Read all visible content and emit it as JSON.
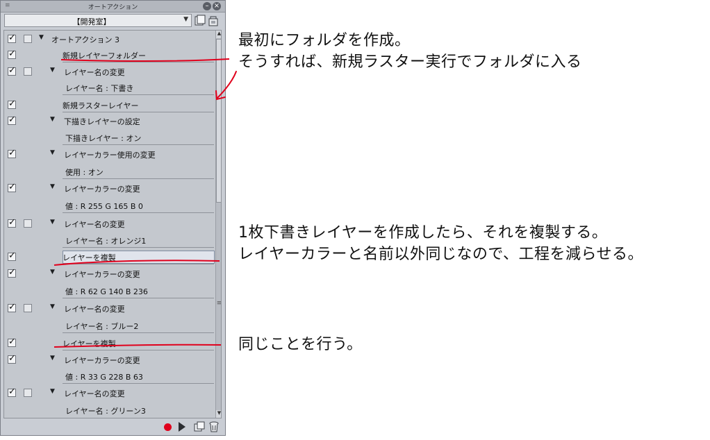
{
  "panel": {
    "title": "オートアクション",
    "grip_icon": "≡",
    "set_name": "【開発室】",
    "rows": [
      {
        "label": "オートアクション 3",
        "check": true,
        "toggle": true,
        "tri": true,
        "level": 0
      },
      {
        "label": "新規レイヤーフォルダー",
        "check": true,
        "toggle": false,
        "tri": false,
        "level": 2
      },
      {
        "label": "レイヤー名の変更",
        "check": true,
        "toggle": true,
        "tri": true,
        "level": 1
      },
      {
        "label": "レイヤー名 : 下書き",
        "check": false,
        "toggle": false,
        "tri": false,
        "level": 3
      },
      {
        "label": "新規ラスターレイヤー",
        "check": true,
        "toggle": false,
        "tri": false,
        "level": 2
      },
      {
        "label": "下描きレイヤーの設定",
        "check": true,
        "toggle": false,
        "tri": true,
        "level": 1
      },
      {
        "label": "下描きレイヤー : オン",
        "check": false,
        "toggle": false,
        "tri": false,
        "level": 3
      },
      {
        "label": "レイヤーカラー使用の変更",
        "check": true,
        "toggle": false,
        "tri": true,
        "level": 1
      },
      {
        "label": "使用 : オン",
        "check": false,
        "toggle": false,
        "tri": false,
        "level": 3
      },
      {
        "label": "レイヤーカラーの変更",
        "check": true,
        "toggle": false,
        "tri": true,
        "level": 1
      },
      {
        "label": "値 : R 255 G 165 B 0",
        "check": false,
        "toggle": false,
        "tri": false,
        "level": 3
      },
      {
        "label": "レイヤー名の変更",
        "check": true,
        "toggle": true,
        "tri": true,
        "level": 1
      },
      {
        "label": "レイヤー名 : オレンジ1",
        "check": false,
        "toggle": false,
        "tri": false,
        "level": 3
      },
      {
        "label": "レイヤーを複製",
        "check": true,
        "toggle": false,
        "tri": false,
        "level": 2,
        "selected": true
      },
      {
        "label": "レイヤーカラーの変更",
        "check": true,
        "toggle": false,
        "tri": true,
        "level": 1
      },
      {
        "label": "値 : R 62 G 140 B 236",
        "check": false,
        "toggle": false,
        "tri": false,
        "level": 3
      },
      {
        "label": "レイヤー名の変更",
        "check": true,
        "toggle": true,
        "tri": true,
        "level": 1
      },
      {
        "label": "レイヤー名 : ブルー2",
        "check": false,
        "toggle": false,
        "tri": false,
        "level": 3
      },
      {
        "label": "レイヤーを複製",
        "check": true,
        "toggle": false,
        "tri": false,
        "level": 2
      },
      {
        "label": "レイヤーカラーの変更",
        "check": true,
        "toggle": false,
        "tri": true,
        "level": 1
      },
      {
        "label": "値 : R 33 G 228 B 63",
        "check": false,
        "toggle": false,
        "tri": false,
        "level": 3
      },
      {
        "label": "レイヤー名の変更",
        "check": true,
        "toggle": true,
        "tri": true,
        "level": 1
      },
      {
        "label": "レイヤー名 : グリーン3",
        "check": false,
        "toggle": false,
        "tri": false,
        "level": 3
      }
    ]
  },
  "annotations": {
    "note1_line1": "最初にフォルダを作成。",
    "note1_line2": "そうすれば、新規ラスター実行でフォルダに入る",
    "note2_line1": "1枚下書きレイヤーを作成したら、それを複製する。",
    "note2_line2": "レイヤーカラーと名前以外同じなので、工程を減らせる。",
    "note3_line1": "同じことを行う。"
  },
  "colors": {
    "panel_bg": "#c9cdd4",
    "annotation_red": "#e0001c",
    "record_red": "#e0001c"
  }
}
